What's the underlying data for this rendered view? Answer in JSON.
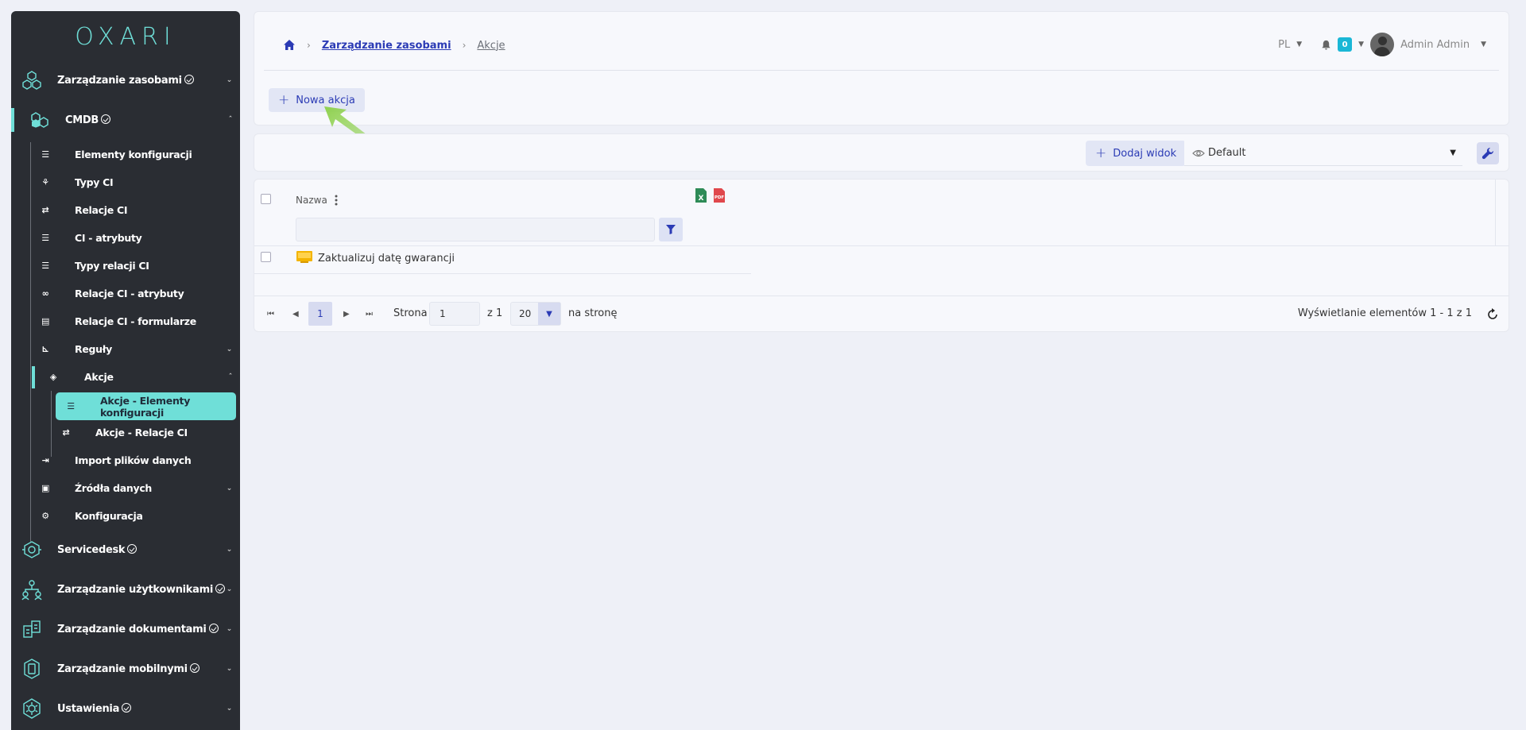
{
  "sidebar": {
    "logo": "OXARI",
    "top_items": [
      {
        "label": "Zarządzanie zasobami",
        "icon": "hexagon-network-icon"
      },
      {
        "label": "CMDB",
        "icon": "cmdb-hexagons-icon"
      },
      {
        "label": "Servicedesk",
        "icon": "servicedesk-icon"
      },
      {
        "label": "Zarządzanie użytkownikami",
        "icon": "users-hierarchy-icon"
      },
      {
        "label": "Zarządzanie dokumentami",
        "icon": "documents-icon"
      },
      {
        "label": "Zarządzanie mobilnymi",
        "icon": "mobile-icon"
      },
      {
        "label": "Ustawienia",
        "icon": "settings-hexagon-icon"
      }
    ],
    "cmdb_items": [
      {
        "label": "Elementy konfiguracji",
        "icon": "list-icon"
      },
      {
        "label": "Typy CI",
        "icon": "shapes-icon"
      },
      {
        "label": "Relacje CI",
        "icon": "swap-icon"
      },
      {
        "label": "CI - atrybuty",
        "icon": "list-icon"
      },
      {
        "label": "Typy relacji CI",
        "icon": "list-icon"
      },
      {
        "label": "Relacje CI - atrybuty",
        "icon": "link-icon"
      },
      {
        "label": "Relacje CI - formularze",
        "icon": "form-icon"
      },
      {
        "label": "Reguły",
        "icon": "chart-icon"
      },
      {
        "label": "Akcje",
        "icon": "target-icon"
      },
      {
        "label": "Akcje - Elementy konfiguracji",
        "icon": "list-icon"
      },
      {
        "label": "Akcje - Relacje CI",
        "icon": "swap-icon"
      },
      {
        "label": "Import plików danych",
        "icon": "import-icon"
      },
      {
        "label": "Źródła danych",
        "icon": "box-icon"
      },
      {
        "label": "Konfiguracja",
        "icon": "gears-icon"
      }
    ]
  },
  "header": {
    "breadcrumb": [
      "Zarządzanie zasobami",
      "Akcje"
    ],
    "lang": "PL",
    "notifications": "0",
    "user": "Admin Admin"
  },
  "toolbar": {
    "new_action": "Nowa akcja",
    "add_view": "Dodaj widok",
    "view_select": "Default"
  },
  "table": {
    "column": "Nazwa",
    "rows": [
      {
        "name": "Zaktualizuj datę gwarancji"
      }
    ]
  },
  "pager": {
    "current_page": "1",
    "page_label": "Strona",
    "page_input": "1",
    "of_label": "z 1",
    "page_size": "20",
    "per_page_label": "na stronę",
    "summary": "Wyświetlanie elementów 1 - 1 z 1"
  },
  "colors": {
    "accent": "#6fdfd8",
    "primary": "#2b3bb5",
    "sidebar_bg": "#2a2d33",
    "page_bg": "#eef0f7",
    "arrow": "#8fd14f"
  }
}
